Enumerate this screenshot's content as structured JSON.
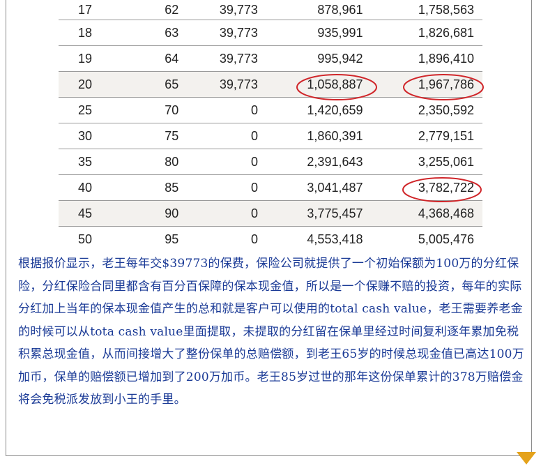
{
  "table": {
    "rows": [
      {
        "c1": "17",
        "c2": "62",
        "c3": "39,773",
        "c4": "878,961",
        "c5": "1,758,563"
      },
      {
        "c1": "18",
        "c2": "63",
        "c3": "39,773",
        "c4": "935,991",
        "c5": "1,826,681"
      },
      {
        "c1": "19",
        "c2": "64",
        "c3": "39,773",
        "c4": "995,942",
        "c5": "1,896,410"
      },
      {
        "c1": "20",
        "c2": "65",
        "c3": "39,773",
        "c4": "1,058,887",
        "c5": "1,967,786"
      },
      {
        "c1": "25",
        "c2": "70",
        "c3": "0",
        "c4": "1,420,659",
        "c5": "2,350,592"
      },
      {
        "c1": "30",
        "c2": "75",
        "c3": "0",
        "c4": "1,860,391",
        "c5": "2,779,151"
      },
      {
        "c1": "35",
        "c2": "80",
        "c3": "0",
        "c4": "2,391,643",
        "c5": "3,255,061"
      },
      {
        "c1": "40",
        "c2": "85",
        "c3": "0",
        "c4": "3,041,487",
        "c5": "3,782,722"
      },
      {
        "c1": "45",
        "c2": "90",
        "c3": "0",
        "c4": "3,775,457",
        "c5": "4,368,468"
      },
      {
        "c1": "50",
        "c2": "95",
        "c3": "0",
        "c4": "4,553,418",
        "c5": "5,005,476"
      }
    ],
    "highlight_color": "#d0262a",
    "shade_color": "#f3f1ee"
  },
  "paragraph": {
    "text": "根据报价显示，老王每年交$39773的保费，保险公司就提供了一个初始保额为100万的分红保险，分红保险合同里都含有百分百保障的保本现金值，所以是一个保赚不赔的投资，每年的实际分红加上当年的保本现金值产生的总和就是客户可以使用的total cash value，老王需要养老金的时候可以从tota cash value里面提取，未提取的分红留在保单里经过时间复利逐年累加免税积累总现金值，从而间接增大了整份保单的总赔偿额，到老王65岁的时候总现金值已高达100万加币，保单的赔偿额已增加到了200万加币。老王85岁过世的那年这份保单累计的378万赔偿金将会免税派发放到小王的手里。"
  },
  "accent_color": "#e4a21b"
}
